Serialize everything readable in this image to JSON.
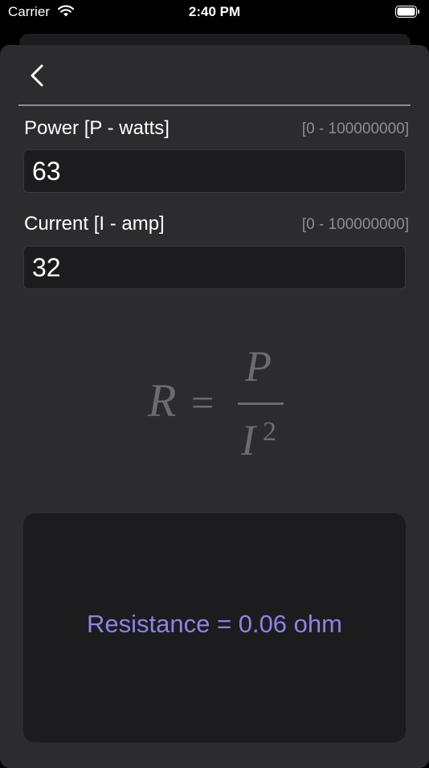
{
  "status_bar": {
    "carrier": "Carrier",
    "time": "2:40 PM"
  },
  "nav": {
    "back_icon": "chevron-left-icon"
  },
  "fields": [
    {
      "label": "Power [P - watts]",
      "range": "[0 - 100000000]",
      "value": "63"
    },
    {
      "label": "Current [I - amp]",
      "range": "[0 - 100000000]",
      "value": "32"
    }
  ],
  "formula": {
    "lhs": "R",
    "eq": "=",
    "numerator": "P",
    "denominator": "I",
    "exponent": "2"
  },
  "result": {
    "text": "Resistance = 0.06 ohm"
  },
  "colors": {
    "result": "#8a84e8",
    "sheet": "#2c2c2e",
    "card": "#1c1c1e"
  }
}
